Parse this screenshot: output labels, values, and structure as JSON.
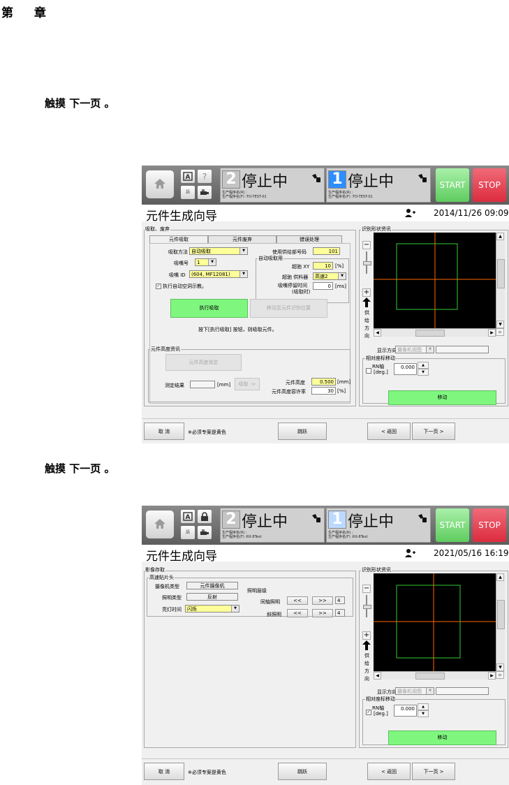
{
  "doc": {
    "chapter": "第 章",
    "step1": "触摸 下一页 。",
    "step2": "触摸 下一页 。"
  },
  "colors": {
    "accent_blue": "#2e8dff",
    "start_green": "#5fcc5f",
    "stop_red": "#dc2c3e",
    "required_yellow": "#ffff99",
    "action_green": "#7ff77f",
    "view_black": "#000000",
    "frame_green": "#33cc33",
    "crosshair_orange": "#ff6600"
  },
  "shot1": {
    "topbar": {
      "home_icon": "home-icon",
      "icon_a": "a-box-icon",
      "icon_help": "question-mark-icon",
      "icon_japanese": "語",
      "icon_usb": "usb-icon",
      "lane2": {
        "number": "2",
        "status": "停止中",
        "prog_line1": "生产程序名(R) :",
        "prog_line2": "生产程序名(F) :TO-TEST-01"
      },
      "lane1": {
        "number": "1",
        "status": "停止中",
        "prog_line1": "生产程序名(R) :",
        "prog_line2": "生产程序名(F) :TO-TEST-01"
      },
      "start": "START",
      "stop": "STOP"
    },
    "title": "元件生成向导",
    "datetime": "2014/11/26 09:09",
    "left_group": "吸取、废弃",
    "tabs": [
      "元件吸取",
      "元件废弃",
      "错误处理"
    ],
    "pickup_method_label": "吸取方法",
    "pickup_method": "自动吸取",
    "nozzle_no_label": "吸嘴号",
    "nozzle_no": "1",
    "nozzle_id_label": "吸嘴 ID",
    "nozzle_id": "(604, MF12081)",
    "auto_teach": "执行自动空洞示教。",
    "feeder_pn_label": "使用供给部号码",
    "feeder_pn": "101",
    "auto_pick_group": "自动吸取用",
    "max_xy_label": "超驰 XY",
    "max_xy": "10",
    "max_xy_unit": "[%]",
    "feeder_speed_label": "超驰 供料器",
    "feeder_speed": "高速2",
    "stop_time_label1": "吸嘴停留时间",
    "stop_time_label2": "(吸取时)",
    "stop_time": "0",
    "stop_time_unit": "[ms]",
    "exec_pick": "执行吸取",
    "move_recog": "移动至元件识别位置",
    "instruction": "按下[执行吸取] 按钮，则吸取元件。",
    "height_group": "元件高度资讯",
    "measure_height": "元件高度测定",
    "measure_result_label": "测定结果",
    "measure_unit": "[mm]",
    "apply": "吸取 ->",
    "part_height_label": "元件高度",
    "part_height": "0.500",
    "part_height_unit": "[mm]",
    "tolerance_label": "元件高度容许率",
    "tolerance": "30",
    "tolerance_unit": "[%]",
    "recog_group": "识别形状资讯",
    "supply_dir": [
      "供",
      "给",
      "方",
      "向"
    ],
    "display_dir_label": "显示方向",
    "display_dir": "摄像机视图",
    "relative_move_group": "相对座标移动",
    "rn_axis_label": "RN轴",
    "rn_unit": "[deg.]",
    "rn_value": "0.000",
    "rn_checked": false,
    "move": "移动",
    "bottom": {
      "cancel": "取 消",
      "note": "※必须专案是黄色",
      "skip": "跳跃",
      "back": "< 返回",
      "next": "下一页 >"
    }
  },
  "shot2": {
    "topbar": {
      "home_icon": "home-icon",
      "icon_a": "a-box-icon",
      "icon_lock": "lock-icon",
      "icon_japanese": "語",
      "icon_usb": "usb-icon",
      "lane2": {
        "number": "2",
        "status": "停止中",
        "prog_line1": "生产程序名(R) :",
        "prog_line2": "生产程序名(F) :RX-8Test"
      },
      "lane1": {
        "number": "1",
        "status": "停止中",
        "prog_line1": "生产程序名(R) :",
        "prog_line2": "生产程序名(F) :RX-8Test"
      },
      "start": "START",
      "stop": "STOP"
    },
    "title": "元件生成向导",
    "datetime": "2021/05/16 16:19",
    "left_group": "影像存取",
    "sub_group": "高速贴片头",
    "camera_type_label": "摄像机类型",
    "camera_type": "元件摄像机",
    "light_type_label": "照明类型",
    "light_type": "反射",
    "light_time_label": "亮灯时间",
    "light_time": "闪烁",
    "light_level_label": "照明层级",
    "coaxial_label": "同轴照明",
    "coaxial_value": "4",
    "oblique_label": "斜照明",
    "oblique_value": "4",
    "dec": "<<",
    "inc": ">>",
    "recog_group": "识别形状资讯",
    "supply_dir": [
      "供",
      "给",
      "方",
      "向"
    ],
    "display_dir_label": "显示方向",
    "display_dir": "摄像机视图",
    "relative_move_group": "相对座标移动",
    "rn_axis_label": "RN轴",
    "rn_unit": "[deg.]",
    "rn_value": "0.000",
    "rn_checked": true,
    "rn_check_glyph": "✓",
    "move": "移动",
    "bottom": {
      "cancel": "取 消",
      "note": "※必须专案是黄色",
      "skip": "跳跃",
      "back": "< 返回",
      "next": "下一页 >"
    }
  }
}
